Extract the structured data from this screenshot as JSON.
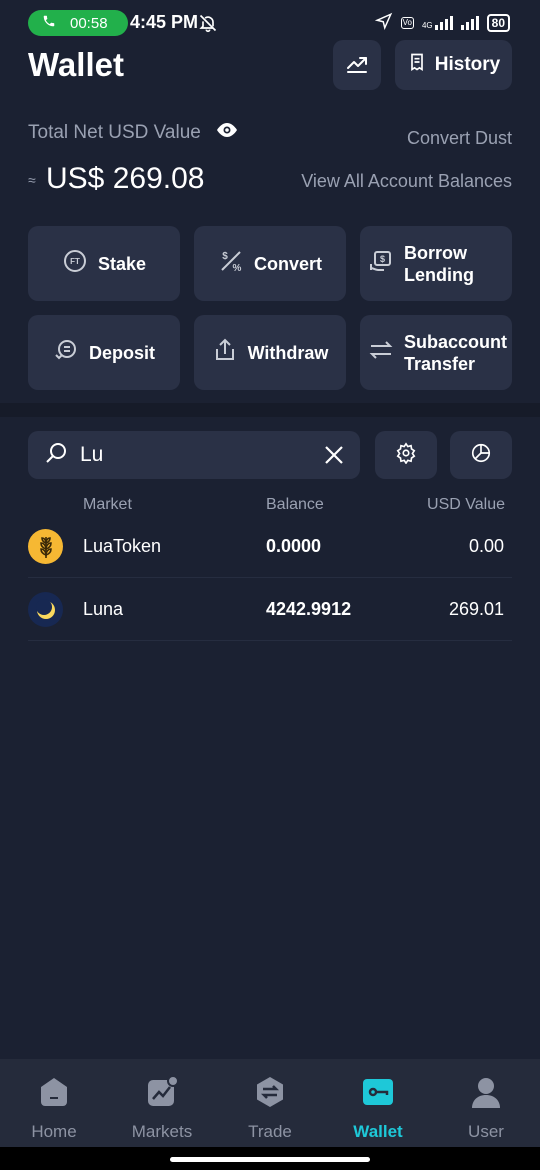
{
  "status_bar": {
    "call_timer": "00:58",
    "time": "4:45 PM",
    "network": "4G",
    "battery": "80"
  },
  "header": {
    "title": "Wallet",
    "history_label": "History"
  },
  "balance": {
    "label": "Total Net USD Value",
    "approx_symbol": "≈",
    "value": "US$ 269.08",
    "convert_dust": "Convert Dust",
    "view_all": "View All Account Balances"
  },
  "actions": [
    {
      "label": "Stake"
    },
    {
      "label": "Convert"
    },
    {
      "label": "Borrow Lending"
    },
    {
      "label": "Deposit"
    },
    {
      "label": "Withdraw"
    },
    {
      "label": "Subaccount Transfer"
    }
  ],
  "search": {
    "value": "Lu"
  },
  "table": {
    "headers": [
      "Market",
      "Balance",
      "USD Value"
    ],
    "rows": [
      {
        "market": "LuaToken",
        "balance": "0.0000",
        "usd": "0.00"
      },
      {
        "market": "Luna",
        "balance": "4242.9912",
        "usd": "269.01"
      }
    ]
  },
  "nav": [
    {
      "label": "Home"
    },
    {
      "label": "Markets"
    },
    {
      "label": "Trade"
    },
    {
      "label": "Wallet"
    },
    {
      "label": "User"
    }
  ],
  "colors": {
    "background": "#1b2132",
    "card": "#2a3146",
    "accent": "#1ec8d8",
    "call_green": "#22b04b"
  }
}
